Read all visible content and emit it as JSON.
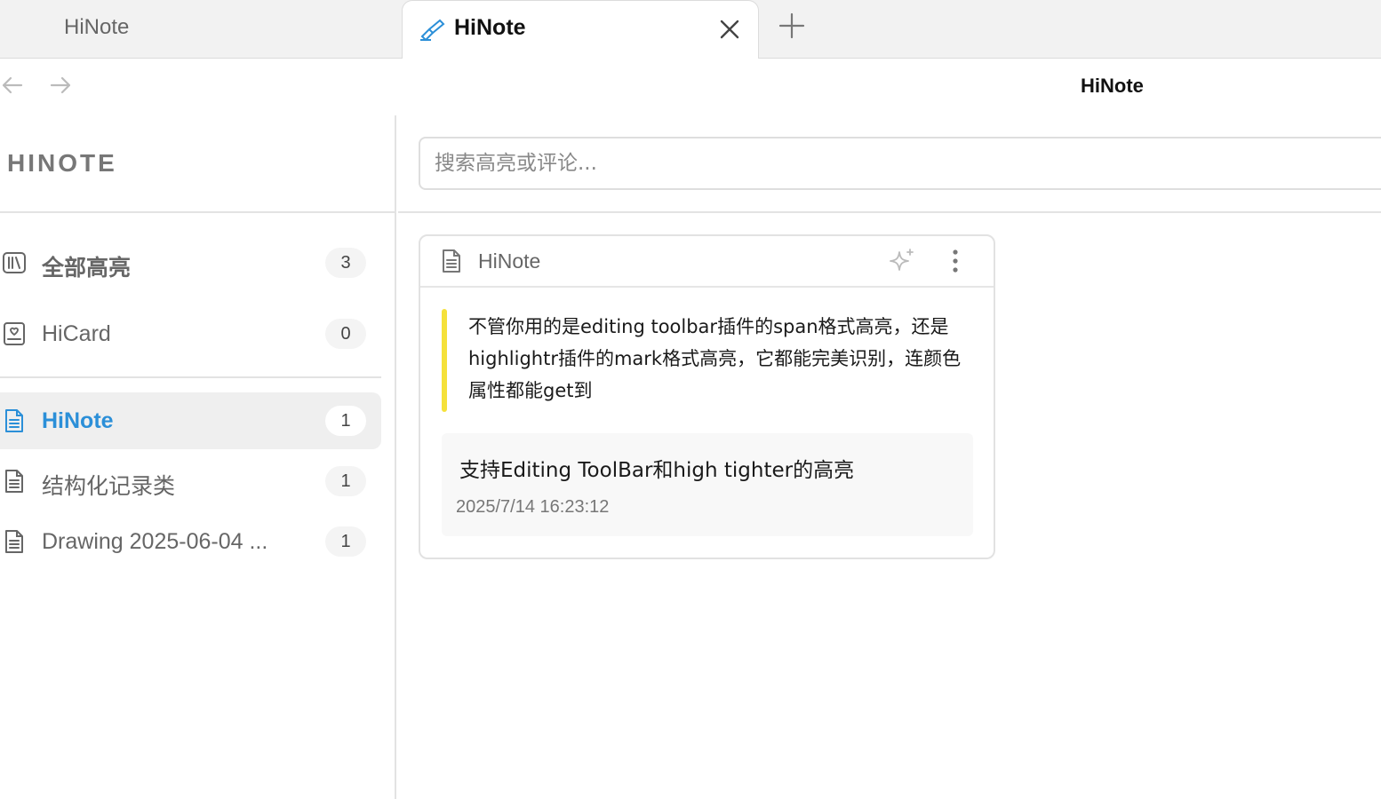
{
  "tabs": [
    {
      "label": "HiNote",
      "active": false
    },
    {
      "label": "HiNote",
      "active": true,
      "icon": "highlighter-icon"
    }
  ],
  "header": {
    "title": "HiNote"
  },
  "sidebar": {
    "heading": "HINOTE",
    "items": [
      {
        "label": "全部高亮",
        "count": "3",
        "icon": "library-icon"
      },
      {
        "label": "HiCard",
        "count": "0",
        "icon": "card-icon"
      },
      {
        "label": "HiNote",
        "count": "1",
        "icon": "file-text-icon",
        "active": true
      },
      {
        "label": "结构化记录类",
        "count": "1",
        "icon": "file-text-icon"
      },
      {
        "label": "Drawing 2025-06-04 ...",
        "count": "1",
        "icon": "file-text-icon"
      }
    ]
  },
  "search": {
    "placeholder": "搜索高亮或评论..."
  },
  "card": {
    "file_name": "HiNote",
    "highlight_text": "不管你用的是editing toolbar插件的span格式高亮，还是highlightr插件的mark格式高亮，它都能完美识别，连颜色属性都能get到",
    "highlight_color": "#f5e13a",
    "comment": {
      "text": "支持Editing ToolBar和high tighter的高亮",
      "timestamp": "2025/7/14 16:23:12"
    }
  },
  "colors": {
    "accent": "#2b8fd8",
    "highlight": "#f5e13a"
  }
}
